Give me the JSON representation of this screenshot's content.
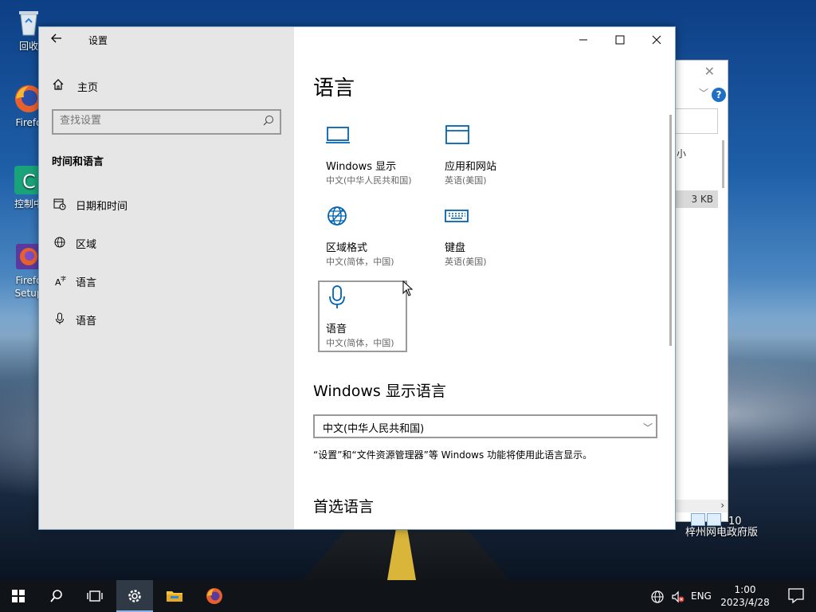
{
  "desktop": {
    "icons": [
      {
        "label": "回收"
      },
      {
        "label": "Firefo"
      },
      {
        "label": "控制中"
      },
      {
        "label": "Firefo\nSetup"
      }
    ],
    "watermark_line1": "10",
    "watermark_line2": "梓州网电政府版"
  },
  "background_window": {
    "size_text": "3 KB",
    "partial_text": "小"
  },
  "settings": {
    "window_title": "设置",
    "home_label": "主页",
    "search_placeholder": "查找设置",
    "section_heading": "时间和语言",
    "nav_items": [
      {
        "label": "日期和时间",
        "icon": "calendar-clock-icon"
      },
      {
        "label": "区域",
        "icon": "globe-pin-icon"
      },
      {
        "label": "语言",
        "icon": "language-icon"
      },
      {
        "label": "语音",
        "icon": "microphone-icon"
      }
    ],
    "page_title": "语言",
    "tiles": [
      {
        "name": "Windows 显示",
        "sub": "中文(中华人民共和国)",
        "icon": "monitor-icon"
      },
      {
        "name": "应用和网站",
        "sub": "英语(美国)",
        "icon": "browser-window-icon"
      },
      {
        "name": "区域格式",
        "sub": "中文(简体，中国)",
        "icon": "globe-settings-icon"
      },
      {
        "name": "键盘",
        "sub": "英语(美国)",
        "icon": "keyboard-icon"
      },
      {
        "name": "语音",
        "sub": "中文(简体，中国)",
        "icon": "microphone-icon"
      }
    ],
    "display_language_heading": "Windows 显示语言",
    "display_language_value": "中文(中华人民共和国)",
    "display_language_desc": "“设置”和“文件资源管理器”等 Windows 功能将使用此语言显示。",
    "preferred_heading": "首选语言",
    "accent_color": "#0063b1"
  },
  "taskbar": {
    "language": "ENG",
    "time": "1:00",
    "date": "2023/4/28"
  }
}
